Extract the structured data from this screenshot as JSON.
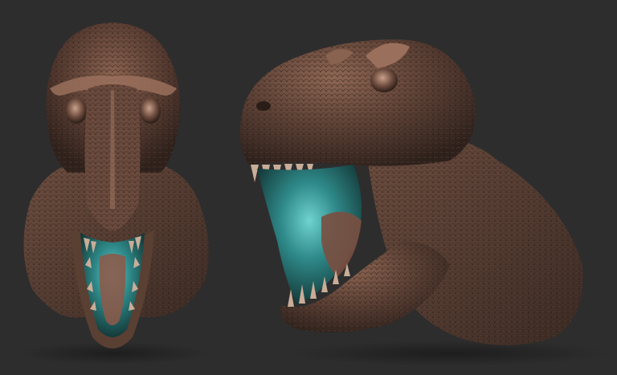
{
  "scene": {
    "background": "#2d2d2d",
    "subject": "sculpted-dinosaur-head",
    "views": [
      "front-view",
      "three-quarter-view"
    ],
    "colors": {
      "skin_dark": "#3b2a23",
      "skin_mid": "#6b4a3c",
      "skin_highlight": "#b98a73",
      "mouth_teal": "#2f8a8a",
      "mouth_teal_light": "#6fd3cf",
      "teeth": "#c9ad98"
    }
  }
}
